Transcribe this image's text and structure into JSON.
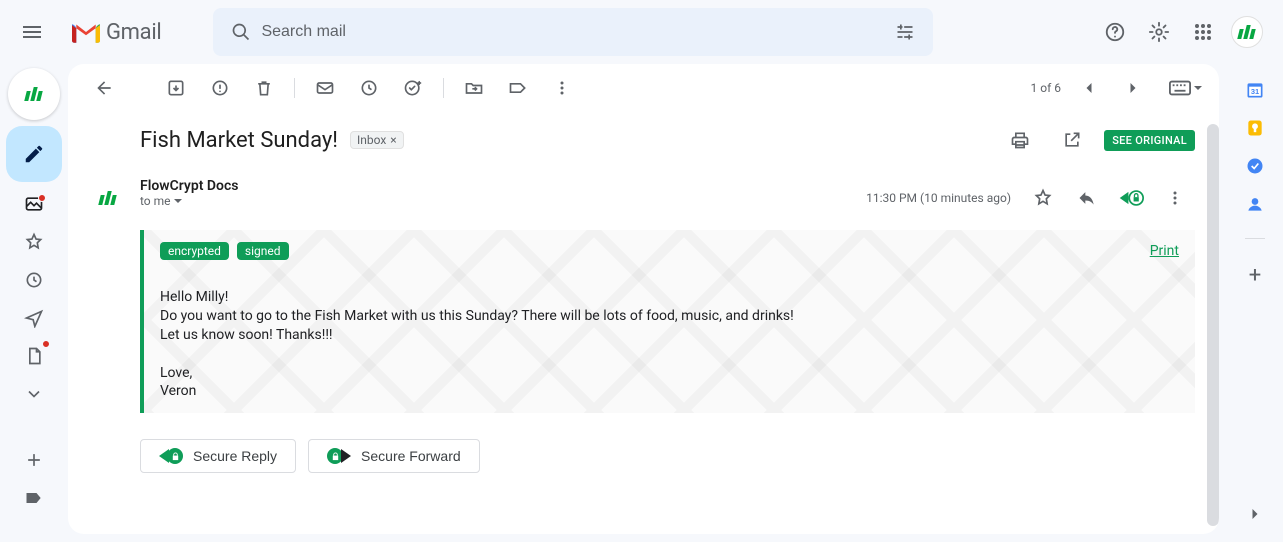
{
  "header": {
    "product_name": "Gmail",
    "search_placeholder": "Search mail"
  },
  "toolbar": {
    "counter": "1 of 6"
  },
  "message": {
    "subject": "Fish Market Sunday!",
    "inbox_chip": "Inbox",
    "see_original": "SEE ORIGINAL",
    "sender_name": "FlowCrypt Docs",
    "to_line": "to me",
    "timestamp": "11:30 PM (10 minutes ago)",
    "badge_encrypted": "encrypted",
    "badge_signed": "signed",
    "print_label": "Print",
    "body": "Hello Milly!\nDo you want to go to the Fish Market with us this Sunday? There will be lots of food, music, and drinks!\nLet us know soon! Thanks!!!\n\nLove,\nVeron"
  },
  "actions": {
    "secure_reply": "Secure Reply",
    "secure_forward": "Secure Forward"
  }
}
